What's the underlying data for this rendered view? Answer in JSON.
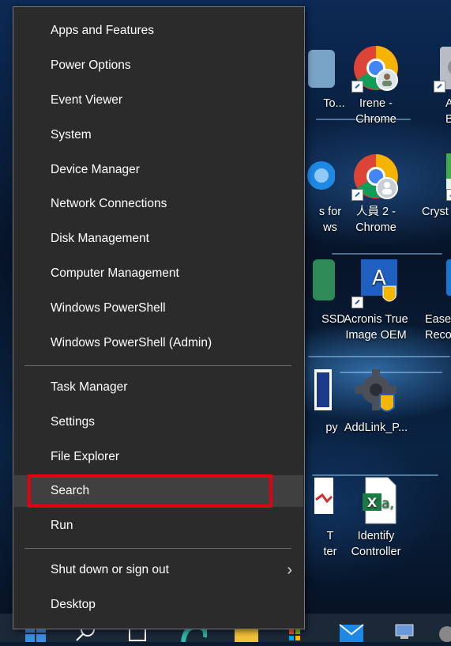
{
  "context_menu": {
    "items": [
      {
        "label": "Apps and Features"
      },
      {
        "label": "Power Options"
      },
      {
        "label": "Event Viewer"
      },
      {
        "label": "System"
      },
      {
        "label": "Device Manager"
      },
      {
        "label": "Network Connections"
      },
      {
        "label": "Disk Management"
      },
      {
        "label": "Computer Management"
      },
      {
        "label": "Windows PowerShell"
      },
      {
        "label": "Windows PowerShell (Admin)"
      },
      {
        "label": "Task Manager"
      },
      {
        "label": "Settings"
      },
      {
        "label": "File Explorer"
      },
      {
        "label": "Search"
      },
      {
        "label": "Run"
      },
      {
        "label": "Shut down or sign out"
      },
      {
        "label": "Desktop"
      }
    ],
    "highlighted_item": "Search",
    "highlight_color": "#e3000f"
  },
  "desktop_icons": [
    {
      "label": "To..."
    },
    {
      "label": "Irene -\nChrome"
    },
    {
      "label": "AS\nBenc"
    },
    {
      "label": "s for\nws"
    },
    {
      "label": "人員 2 -\nChrome"
    },
    {
      "label": "Cryst"
    },
    {
      "label": "SSD"
    },
    {
      "label": "Acronis True\nImage OEM"
    },
    {
      "label": "Ease\nReco"
    },
    {
      "label": "py"
    },
    {
      "label": "AddLink_P..."
    },
    {
      "label": "T\nter"
    },
    {
      "label": "Identify\nController"
    }
  ],
  "colors": {
    "menu_bg": "#2b2b2b",
    "menu_hover": "#404040",
    "menu_text": "#ffffff"
  }
}
